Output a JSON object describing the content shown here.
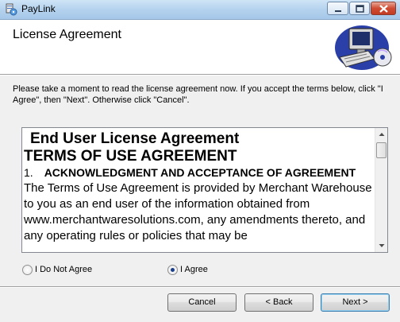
{
  "window": {
    "title": "PayLink"
  },
  "header": {
    "title": "License Agreement"
  },
  "instructions": "Please take a moment to read the license agreement now. If you accept the terms below, click \"I Agree\", then \"Next\". Otherwise click \"Cancel\".",
  "eula": {
    "heading": "End User License Agreement",
    "subheading": "TERMS OF USE AGREEMENT",
    "section_number": "1.",
    "section_title": "ACKNOWLEDGMENT AND ACCEPTANCE OF AGREEMENT",
    "body": "The Terms of Use Agreement is provided by Merchant Warehouse to you as an end user of the information obtained from www.merchantwaresolutions.com, any amendments thereto, and any operating rules or policies that may be"
  },
  "options": {
    "disagree_label": "I Do Not Agree",
    "agree_label": "I Agree",
    "selected": "agree"
  },
  "buttons": {
    "cancel": "Cancel",
    "back": "< Back",
    "next": "Next >"
  },
  "icons": {
    "app": "installer-icon",
    "header": "computer-cd-icon",
    "minimize": "minimize-icon",
    "maximize": "maximize-icon",
    "close": "close-icon"
  }
}
